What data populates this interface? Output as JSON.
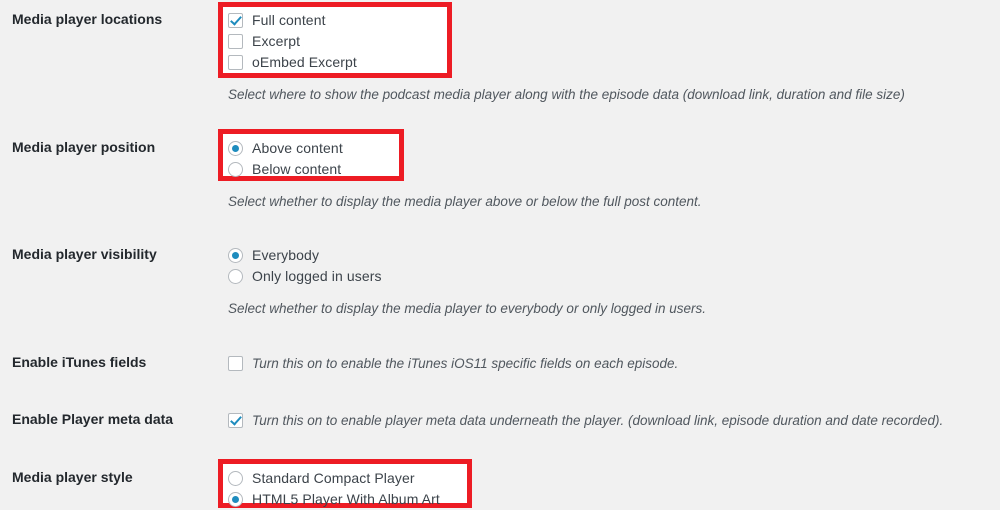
{
  "theme": {
    "background": "#f1f1f1",
    "label_color": "#23282d",
    "text_color": "#3c434a",
    "description_color": "#50575e",
    "accent": "#1e8cbe",
    "highlight_border": "#ed1c24",
    "control_border": "#b4b9be"
  },
  "settings": [
    {
      "id": "media-player-locations",
      "label": "Media player locations",
      "control_type": "checkbox-group",
      "highlighted": true,
      "options": [
        {
          "label": "Full content",
          "checked": true
        },
        {
          "label": "Excerpt",
          "checked": false
        },
        {
          "label": "oEmbed Excerpt",
          "checked": false
        }
      ],
      "description": "Select where to show the podcast media player along with the episode data (download link, duration and file size)"
    },
    {
      "id": "media-player-position",
      "label": "Media player position",
      "control_type": "radio-group",
      "highlighted": true,
      "options": [
        {
          "label": "Above content",
          "checked": true
        },
        {
          "label": "Below content",
          "checked": false
        }
      ],
      "description": "Select whether to display the media player above or below the full post content."
    },
    {
      "id": "media-player-visibility",
      "label": "Media player visibility",
      "control_type": "radio-group",
      "highlighted": false,
      "options": [
        {
          "label": "Everybody",
          "checked": true
        },
        {
          "label": "Only logged in users",
          "checked": false
        }
      ],
      "description": "Select whether to display the media player to everybody or only logged in users."
    },
    {
      "id": "enable-itunes-fields",
      "label": "Enable iTunes fields",
      "control_type": "checkbox-inline",
      "highlighted": false,
      "options": [
        {
          "label": "Turn this on to enable the iTunes iOS11 specific fields on each episode.",
          "checked": false
        }
      ],
      "description": ""
    },
    {
      "id": "enable-player-meta-data",
      "label": "Enable Player meta data",
      "control_type": "checkbox-inline",
      "highlighted": false,
      "options": [
        {
          "label": "Turn this on to enable player meta data underneath the player. (download link, episode duration and date recorded).",
          "checked": true
        }
      ],
      "description": ""
    },
    {
      "id": "media-player-style",
      "label": "Media player style",
      "control_type": "radio-group",
      "highlighted": true,
      "options": [
        {
          "label": "Standard Compact Player",
          "checked": false
        },
        {
          "label": "HTML5 Player With Album Art",
          "checked": true
        }
      ],
      "description": ""
    }
  ]
}
